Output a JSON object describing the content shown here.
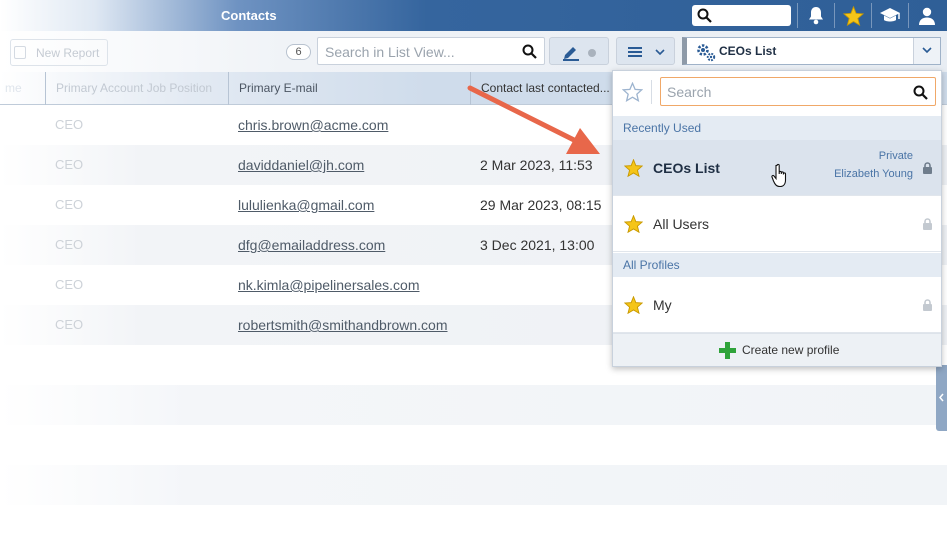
{
  "header": {
    "title": "Contacts",
    "icons": [
      "search-icon",
      "bell-icon",
      "star-icon",
      "graduation-cap-icon",
      "user-icon"
    ]
  },
  "toolbar": {
    "new_report_label": "New Report",
    "record_count": "6",
    "search_placeholder": "Search in List View...",
    "profile_selected": "CEOs List"
  },
  "table": {
    "columns": [
      "me",
      "Primary Account Job Position",
      "Primary E-mail",
      "Contact last contacted..."
    ],
    "rows": [
      {
        "position": "CEO",
        "email": "chris.brown@acme.com",
        "last_contacted": ""
      },
      {
        "position": "CEO",
        "email": "daviddaniel@jh.com",
        "last_contacted": "2 Mar 2023, 11:53"
      },
      {
        "position": "CEO",
        "email": "lululienka@gmail.com",
        "last_contacted": "29 Mar 2023, 08:15"
      },
      {
        "position": "CEO",
        "email": "dfg@emailaddress.com",
        "last_contacted": "3 Dec 2021, 13:00"
      },
      {
        "position": "CEO",
        "email": "nk.kimla@pipelinersales.com",
        "last_contacted": ""
      },
      {
        "position": "CEO",
        "email": "robertsmith@smithandbrown.com",
        "last_contacted": ""
      }
    ]
  },
  "dropdown": {
    "search_placeholder": "Search",
    "recently_used_label": "Recently Used",
    "all_profiles_label": "All Profiles",
    "items": [
      {
        "name": "CEOs List",
        "visibility": "Private",
        "owner": "Elizabeth Young"
      },
      {
        "name": "All Users"
      },
      {
        "name": "My"
      }
    ],
    "create_label": "Create new profile"
  },
  "colors": {
    "header_blue": "#2f5f97",
    "star_yellow": "#f5c518",
    "accent_orange": "#e8674a",
    "create_green": "#2fa33a"
  }
}
